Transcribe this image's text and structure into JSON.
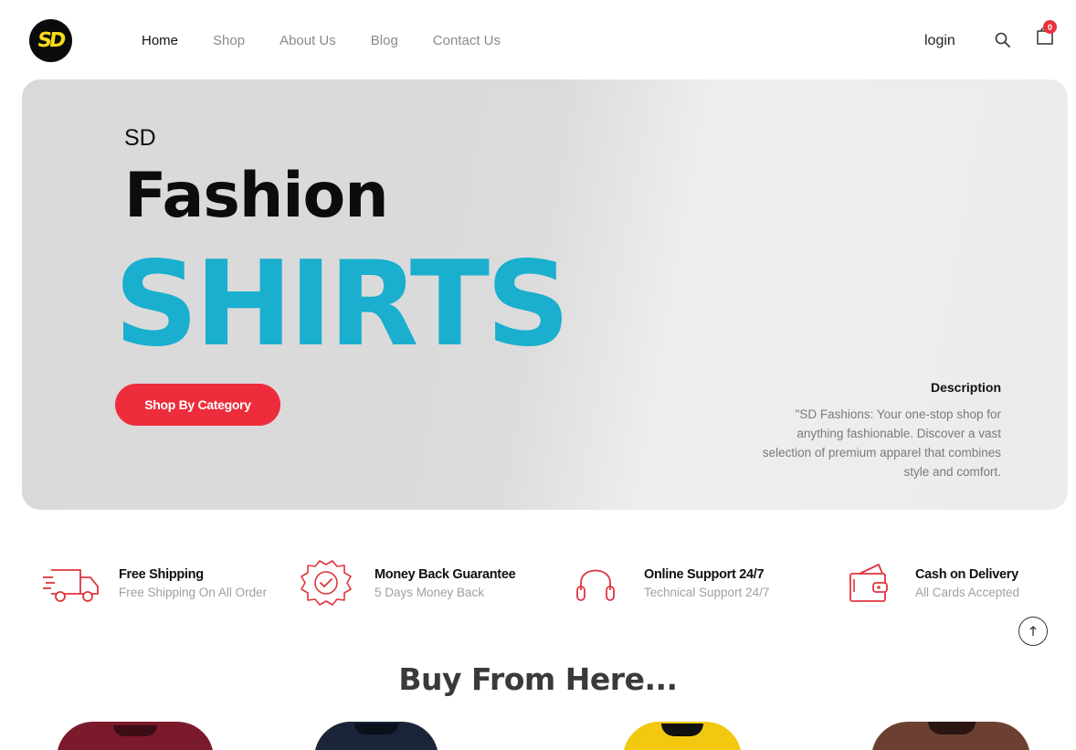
{
  "header": {
    "logo_text": "SD",
    "nav": [
      "Home",
      "Shop",
      "About Us",
      "Blog",
      "Contact Us"
    ],
    "login": "login",
    "cart_count": "0"
  },
  "hero": {
    "brand": "SD",
    "headline": "Fashion",
    "product": "SHIRTS",
    "cta": "Shop By Category",
    "description_title": "Description",
    "description": "\"SD Fashions: Your one-stop shop for anything fashionable. Discover a vast selection of premium apparel that combines style and comfort."
  },
  "features": [
    {
      "icon": "delivery-truck-icon",
      "title": "Free Shipping",
      "subtitle": "Free Shipping On All Order"
    },
    {
      "icon": "badge-check-icon",
      "title": "Money Back Guarantee",
      "subtitle": "5 Days Money Back"
    },
    {
      "icon": "headphones-icon",
      "title": "Online Support 24/7",
      "subtitle": "Technical Support 24/7"
    },
    {
      "icon": "wallet-icon",
      "title": "Cash on Delivery",
      "subtitle": "All Cards Accepted"
    }
  ],
  "section_title": "Buy From Here...",
  "colors": {
    "accent": "#ee2d3c",
    "hero_text": "#1aafce",
    "shirt_colors": [
      "#7a1a2a",
      "#1b2438",
      "#f2c810",
      "#6b4030"
    ]
  }
}
